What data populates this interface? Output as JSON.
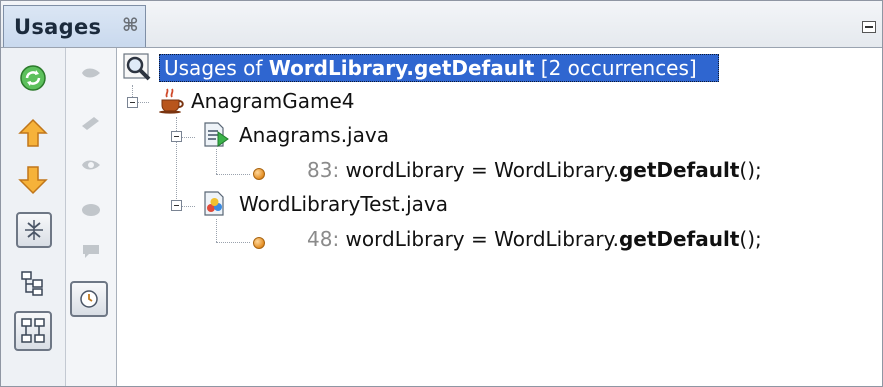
{
  "window": {
    "tab_label": "Usages",
    "close_glyph": "⌘",
    "minimize_icon": "minimize-icon"
  },
  "toolbar_primary": [
    {
      "name": "refresh-icon"
    },
    {
      "name": "previous-occurrence-icon"
    },
    {
      "name": "next-occurrence-icon"
    },
    {
      "name": "collapse-tree-icon",
      "pressed": true
    },
    {
      "name": "logical-view-icon"
    },
    {
      "name": "physical-view-icon",
      "pressed": true
    }
  ],
  "toolbar_secondary": [
    {
      "name": "filter-read-icon"
    },
    {
      "name": "filter-write-icon"
    },
    {
      "name": "filter-read-write-icon"
    },
    {
      "name": "filter-import-icon"
    },
    {
      "name": "filter-comment-icon"
    },
    {
      "name": "filter-test-icon",
      "pressed": true
    }
  ],
  "results": {
    "prefix": "Usages of ",
    "target": "WordLibrary.getDefault",
    "count": "[2 occurrences]",
    "project": "AnagramGame4",
    "files": [
      {
        "name": "Anagrams.java",
        "line": "83:",
        "code_pre": " wordLibrary = WordLibrary.",
        "code_bold": "getDefault",
        "code_post": "();"
      },
      {
        "name": "WordLibraryTest.java",
        "line": "48:",
        "code_pre": " wordLibrary = WordLibrary.",
        "code_bold": "getDefault",
        "code_post": "();"
      }
    ]
  },
  "colors": {
    "selection": "#2f66d0",
    "arrow_orange": "#f0a020",
    "refresh_green": "#3aa64a"
  }
}
